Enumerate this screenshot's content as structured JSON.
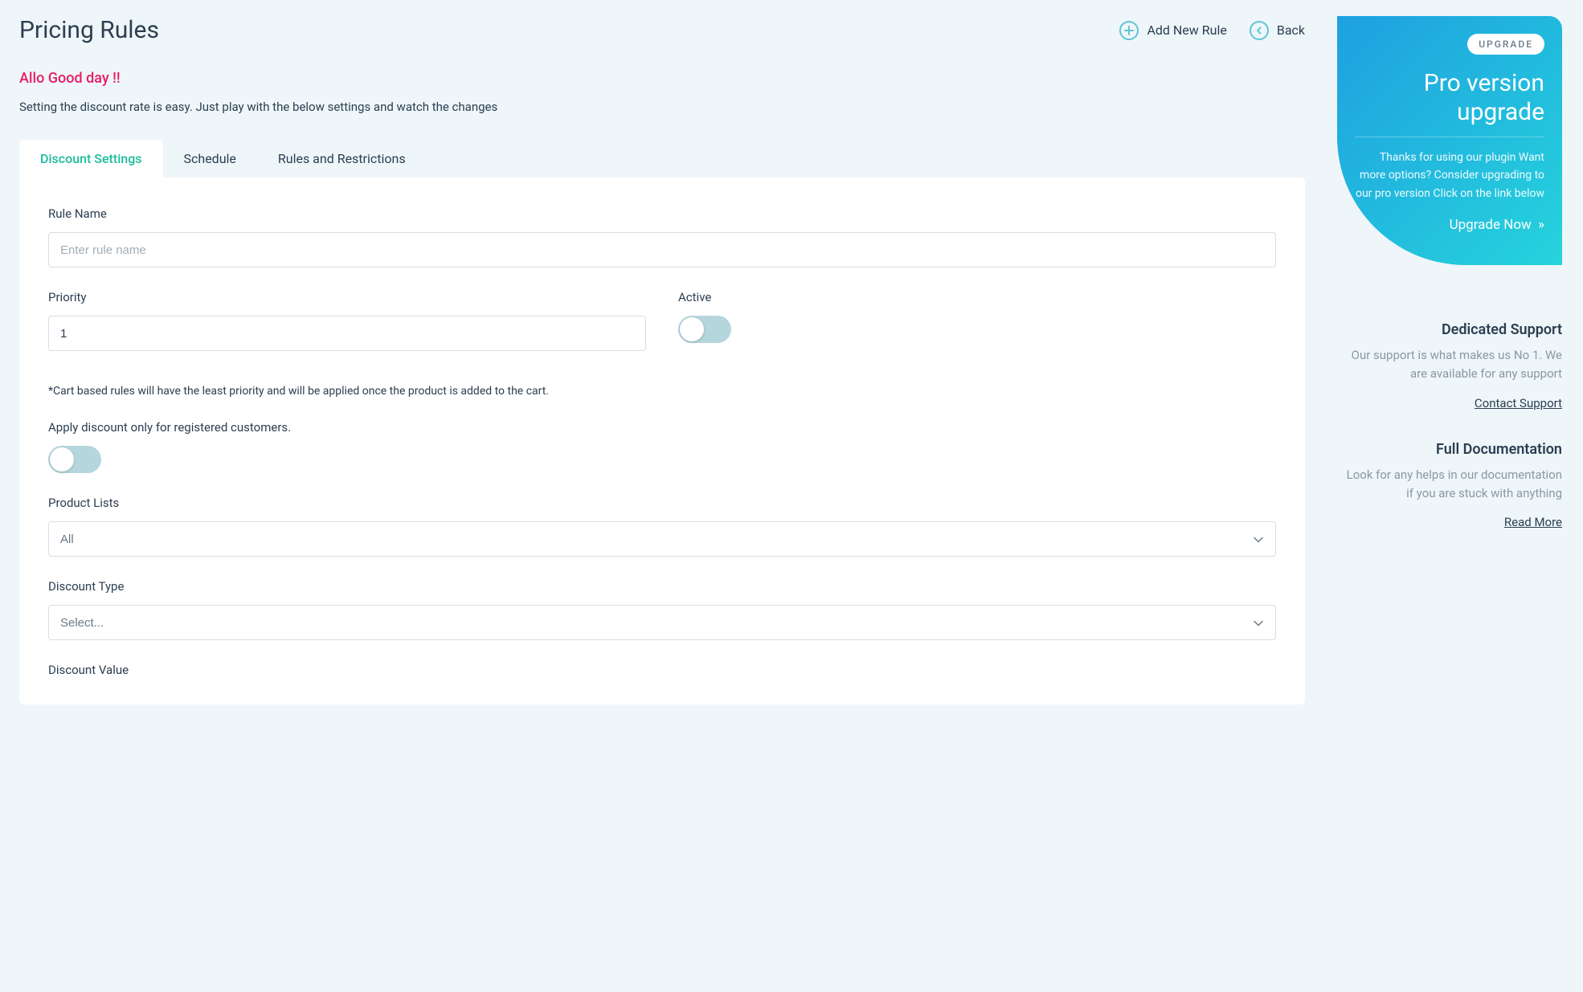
{
  "header": {
    "title": "Pricing Rules",
    "actions": {
      "add": "Add New Rule",
      "back": "Back"
    }
  },
  "intro": {
    "greeting": "Allo Good day !!",
    "desc": "Setting the discount rate is easy. Just play with the below settings and watch the changes"
  },
  "tabs": [
    "Discount Settings",
    "Schedule",
    "Rules and Restrictions"
  ],
  "form": {
    "rule_name": {
      "label": "Rule Name",
      "placeholder": "Enter rule name",
      "value": ""
    },
    "priority": {
      "label": "Priority",
      "value": "1"
    },
    "active": {
      "label": "Active"
    },
    "hint": "*Cart based rules will have the least priority and will be applied once the product is added to the cart.",
    "registered": {
      "label": "Apply discount only for registered customers."
    },
    "product_lists": {
      "label": "Product Lists",
      "value": "All"
    },
    "discount_type": {
      "label": "Discount Type",
      "value": "Select..."
    },
    "discount_value": {
      "label": "Discount Value"
    }
  },
  "sidebar": {
    "upgrade": {
      "pill": "UPGRADE",
      "title": "Pro version upgrade",
      "text": "Thanks for using our plugin Want more options? Consider upgrading to our pro version Click on the link below",
      "link": "Upgrade Now"
    },
    "support": {
      "title": "Dedicated Support",
      "text": "Our support is what makes us No 1. We are available for any support",
      "link": "Contact Support"
    },
    "docs": {
      "title": "Full Documentation",
      "text": "Look for any helps in our documentation if you are stuck with anything",
      "link": "Read More"
    }
  }
}
